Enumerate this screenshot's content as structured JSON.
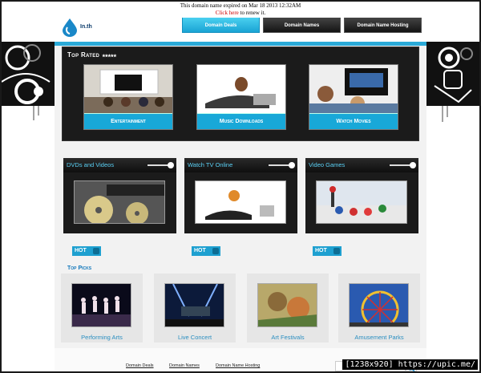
{
  "notice": {
    "line1": "This domain name expired on Mar 18 2013 12:32AM",
    "link": "Click here",
    "line2": " to renew it."
  },
  "header": {
    "logo_text": "In.th",
    "nav": [
      "Domain Deals",
      "Domain Names",
      "Domain Name Hosting"
    ]
  },
  "top_rated": {
    "title": "Top Rated",
    "stars": "★★★★★",
    "items": [
      "Entertainment",
      "Music Downloads",
      "Watch Movies"
    ]
  },
  "categories": [
    {
      "title": "DVDs and Videos",
      "hot": "HOT"
    },
    {
      "title": "Watch TV Online",
      "hot": "HOT"
    },
    {
      "title": "Video Games",
      "hot": "HOT"
    }
  ],
  "top_picks": {
    "title": "Top Picks",
    "items": [
      "Performing Arts",
      "Live Concert",
      "Art Festivals",
      "Amusement Parks"
    ]
  },
  "footer": {
    "links": [
      "Domain Deals",
      "Domain Names",
      "Domain Name Hosting"
    ]
  },
  "badge": "[1238x920] https://upic.me/",
  "colors": {
    "accent": "#1aa4d4",
    "dark": "#1b1b1b"
  }
}
